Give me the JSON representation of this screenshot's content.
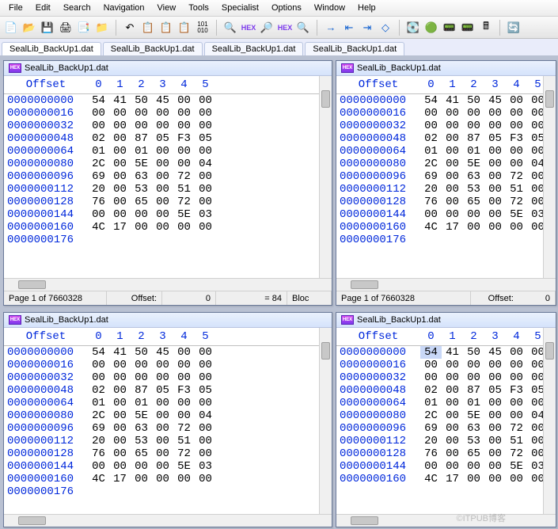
{
  "menu": [
    "File",
    "Edit",
    "Search",
    "Navigation",
    "View",
    "Tools",
    "Specialist",
    "Options",
    "Window",
    "Help"
  ],
  "tabs": [
    {
      "label": "SealLib_BackUp1.dat",
      "active": true
    },
    {
      "label": "SealLib_BackUp1.dat"
    },
    {
      "label": "SealLib_BackUp1.dat"
    },
    {
      "label": "SealLib_BackUp1.dat"
    }
  ],
  "hex": {
    "filename": "SealLib_BackUp1.dat",
    "offset_header": "Offset",
    "cols": [
      "0",
      "1",
      "2",
      "3",
      "4",
      "5"
    ],
    "rows": [
      {
        "offset": "0000000000",
        "bytes": [
          "54",
          "41",
          "50",
          "45",
          "00",
          "00"
        ]
      },
      {
        "offset": "0000000016",
        "bytes": [
          "00",
          "00",
          "00",
          "00",
          "00",
          "00"
        ]
      },
      {
        "offset": "0000000032",
        "bytes": [
          "00",
          "00",
          "00",
          "00",
          "00",
          "00"
        ]
      },
      {
        "offset": "0000000048",
        "bytes": [
          "02",
          "00",
          "87",
          "05",
          "F3",
          "05"
        ]
      },
      {
        "offset": "0000000064",
        "bytes": [
          "01",
          "00",
          "01",
          "00",
          "00",
          "00"
        ]
      },
      {
        "offset": "0000000080",
        "bytes": [
          "2C",
          "00",
          "5E",
          "00",
          "00",
          "04"
        ]
      },
      {
        "offset": "0000000096",
        "bytes": [
          "69",
          "00",
          "63",
          "00",
          "72",
          "00"
        ]
      },
      {
        "offset": "0000000112",
        "bytes": [
          "20",
          "00",
          "53",
          "00",
          "51",
          "00"
        ]
      },
      {
        "offset": "0000000128",
        "bytes": [
          "76",
          "00",
          "65",
          "00",
          "72",
          "00"
        ]
      },
      {
        "offset": "0000000144",
        "bytes": [
          "00",
          "00",
          "00",
          "00",
          "5E",
          "03"
        ]
      },
      {
        "offset": "0000000160",
        "bytes": [
          "4C",
          "17",
          "00",
          "00",
          "00",
          "00"
        ]
      },
      {
        "offset": "0000000176",
        "bytes": [
          "",
          "",
          "",
          "",
          "",
          ""
        ]
      }
    ]
  },
  "status": {
    "page": "Page 1 of 7660328",
    "offset_label": "Offset:",
    "offset_value": "0",
    "eq": "= 84",
    "bloc": "Bloc"
  },
  "watermark": "©ITPUB博客",
  "chart_data": {
    "type": "table",
    "title": "Hex viewer — SealLib_BackUp1.dat (4 synchronized views)",
    "columns": [
      "Offset",
      "0",
      "1",
      "2",
      "3",
      "4",
      "5"
    ],
    "rows": [
      [
        "0000000000",
        "54",
        "41",
        "50",
        "45",
        "00",
        "00"
      ],
      [
        "0000000016",
        "00",
        "00",
        "00",
        "00",
        "00",
        "00"
      ],
      [
        "0000000032",
        "00",
        "00",
        "00",
        "00",
        "00",
        "00"
      ],
      [
        "0000000048",
        "02",
        "00",
        "87",
        "05",
        "F3",
        "05"
      ],
      [
        "0000000064",
        "01",
        "00",
        "01",
        "00",
        "00",
        "00"
      ],
      [
        "0000000080",
        "2C",
        "00",
        "5E",
        "00",
        "00",
        "04"
      ],
      [
        "0000000096",
        "69",
        "00",
        "63",
        "00",
        "72",
        "00"
      ],
      [
        "0000000112",
        "20",
        "00",
        "53",
        "00",
        "51",
        "00"
      ],
      [
        "0000000128",
        "76",
        "00",
        "65",
        "00",
        "72",
        "00"
      ],
      [
        "0000000144",
        "00",
        "00",
        "00",
        "00",
        "5E",
        "03"
      ],
      [
        "0000000160",
        "4C",
        "17",
        "00",
        "00",
        "00",
        "00"
      ]
    ],
    "status_page": "Page 1 of 7660328",
    "status_offset": 0,
    "status_value_dec": 84
  }
}
